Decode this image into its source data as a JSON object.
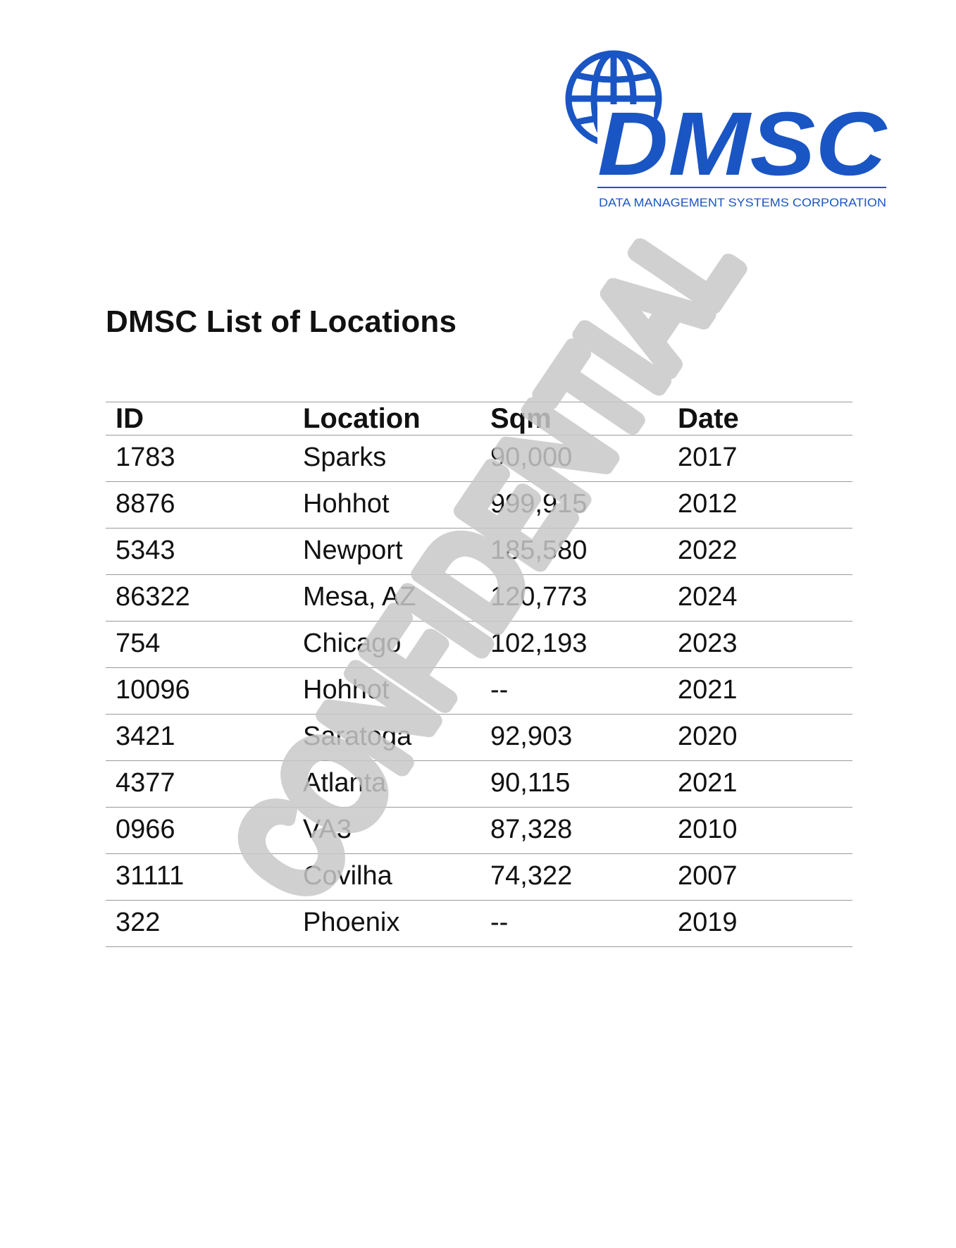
{
  "logo": {
    "wordmark": "DMSC",
    "tagline": "DATA MANAGEMENT SYSTEMS CORPORATION",
    "brand_color": "#1a55c4",
    "icon": "globe-icon"
  },
  "title": "DMSC List of Locations",
  "table": {
    "columns": [
      "ID",
      "Location",
      "Sqm",
      "Date"
    ],
    "rows": [
      {
        "id": "1783",
        "location": "Sparks",
        "sqm": "90,000",
        "date": "2017"
      },
      {
        "id": "8876",
        "location": "Hohhot",
        "sqm": "999,915",
        "date": "2012"
      },
      {
        "id": "5343",
        "location": "Newport",
        "sqm": "185,580",
        "date": "2022"
      },
      {
        "id": "86322",
        "location": "Mesa, AZ",
        "sqm": "120,773",
        "date": "2024"
      },
      {
        "id": "754",
        "location": "Chicago",
        "sqm": "102,193",
        "date": "2023"
      },
      {
        "id": "10096",
        "location": "Hohhot",
        "sqm": "--",
        "date": "2021"
      },
      {
        "id": "3421",
        "location": "Saratoga",
        "sqm": "92,903",
        "date": "2020"
      },
      {
        "id": "4377",
        "location": "Atlanta",
        "sqm": "90,115",
        "date": "2021"
      },
      {
        "id": "0966",
        "location": "VA3",
        "sqm": "87,328",
        "date": "2010"
      },
      {
        "id": "31111",
        "location": "Covilha",
        "sqm": "74,322",
        "date": "2007"
      },
      {
        "id": "322",
        "location": "Phoenix",
        "sqm": "--",
        "date": "2019"
      }
    ]
  },
  "watermark": {
    "text": "CONFIDENTIAL",
    "color": "#c8c8c8"
  }
}
